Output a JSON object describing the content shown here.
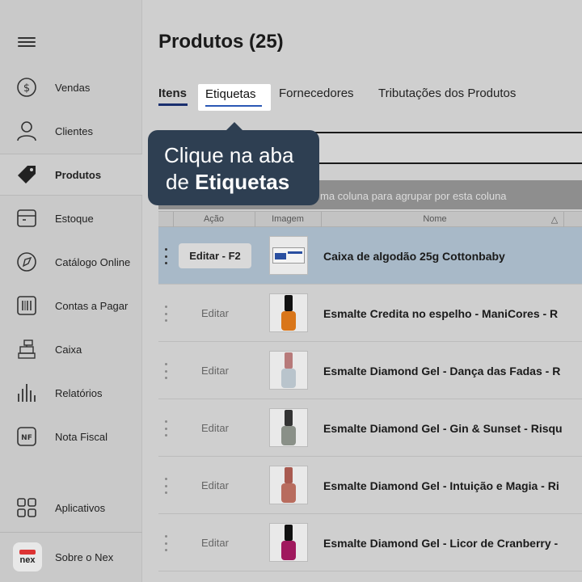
{
  "sidebar": {
    "items": [
      {
        "label": "Vendas",
        "icon": "dollar-circle-icon"
      },
      {
        "label": "Clientes",
        "icon": "user-icon"
      },
      {
        "label": "Produtos",
        "icon": "tag-icon"
      },
      {
        "label": "Estoque",
        "icon": "box-icon"
      },
      {
        "label": "Catálogo Online",
        "icon": "compass-icon"
      },
      {
        "label": "Contas a Pagar",
        "icon": "barcode-icon"
      },
      {
        "label": "Caixa",
        "icon": "cash-register-icon"
      },
      {
        "label": "Relatórios",
        "icon": "bar-chart-icon"
      },
      {
        "label": "Nota Fiscal",
        "icon": "nf-icon"
      }
    ],
    "apps_label": "Aplicativos",
    "about_label": "Sobre o Nex",
    "about_logo_text": "nex"
  },
  "main": {
    "title": "Produtos (25)",
    "tabs": [
      {
        "label": "Itens"
      },
      {
        "label": "Etiquetas"
      },
      {
        "label": "Fornecedores"
      },
      {
        "label": "Tributações dos Produtos"
      }
    ],
    "group_hint": "ma coluna para agrupar por esta coluna",
    "table": {
      "headers": [
        "Ação",
        "Imagem",
        "Nome"
      ],
      "sort_indicator": "△",
      "rows": [
        {
          "action": "Editar - F2",
          "name": "Caixa de algodão 25g Cottonbaby"
        },
        {
          "action": "Editar",
          "name": "Esmalte Credita no espelho - ManiCores - R"
        },
        {
          "action": "Editar",
          "name": "Esmalte Diamond Gel - Dança das Fadas - R"
        },
        {
          "action": "Editar",
          "name": "Esmalte Diamond Gel - Gin & Sunset - Risqu"
        },
        {
          "action": "Editar",
          "name": "Esmalte Diamond Gel - Intuição e Magia - Ri"
        },
        {
          "action": "Editar",
          "name": "Esmalte Diamond Gel - Licor de Cranberry -"
        }
      ]
    }
  },
  "tooltip": {
    "line1": "Clique na aba",
    "line2_prefix": "de ",
    "line2_bold": "Etiquetas"
  },
  "colors": {
    "tooltip_bg": "#2e3f52",
    "selected_row": "#a8b9c8",
    "tab_underline": "#1a2f6e"
  }
}
